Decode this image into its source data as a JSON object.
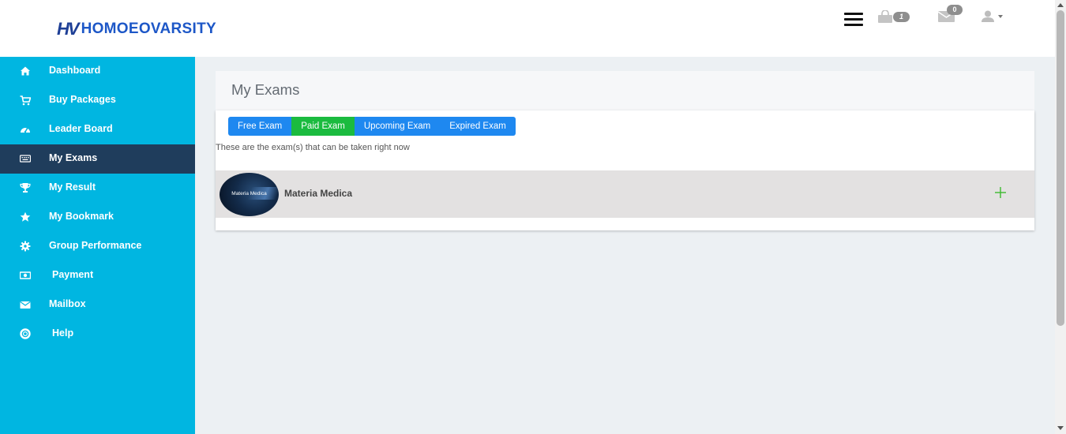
{
  "brand": {
    "mark": "HV",
    "name": "HOMOEOVARSITY",
    "mark_color": "#1e3f96",
    "name_color": "#1d57c7"
  },
  "header": {
    "cart_count": "1",
    "mail_count": "0"
  },
  "sidebar": {
    "bg_color": "#00b6e1",
    "active_color": "#1f3d5c",
    "items": [
      {
        "label": "Dashboard",
        "icon": "home-icon"
      },
      {
        "label": "Buy Packages",
        "icon": "cart-icon"
      },
      {
        "label": "Leader Board",
        "icon": "dashboard-gauge-icon"
      },
      {
        "label": "My Exams",
        "icon": "keyboard-icon",
        "active": true
      },
      {
        "label": "My Result",
        "icon": "trophy-icon"
      },
      {
        "label": "My Bookmark",
        "icon": "star-icon"
      },
      {
        "label": "Group Performance",
        "icon": "gear-icon"
      },
      {
        "label": "Payment",
        "icon": "money-icon"
      },
      {
        "label": "Mailbox",
        "icon": "envelope-icon"
      },
      {
        "label": "Help",
        "icon": "lifebuoy-icon"
      }
    ]
  },
  "main": {
    "title": "My Exams",
    "tabs": [
      {
        "label": "Free Exam"
      },
      {
        "label": "Paid Exam",
        "active": true
      },
      {
        "label": "Upcoming Exam"
      },
      {
        "label": "Expired Exam"
      }
    ],
    "tab_color": "#1e88f0",
    "tab_active_color": "#1bbb3f",
    "description": "These are the exam(s) that can be taken right now",
    "exams": [
      {
        "name": "Materia Medica",
        "thumb_text": "Materia Medica"
      }
    ]
  }
}
